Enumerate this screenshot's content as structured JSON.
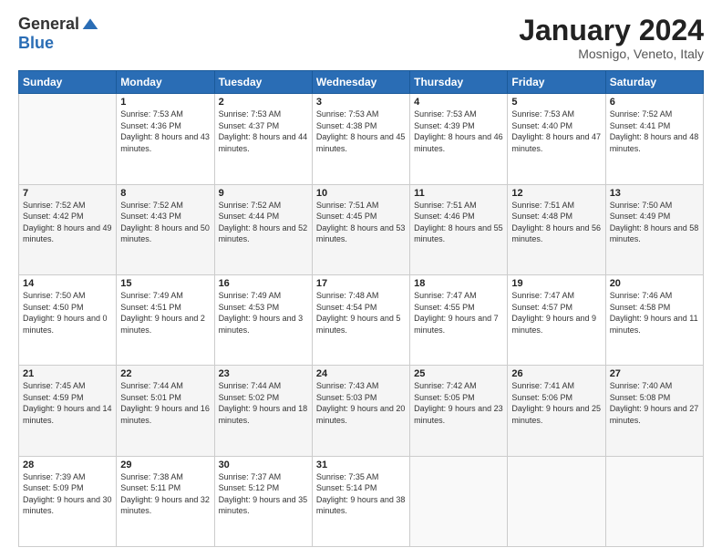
{
  "logo": {
    "general": "General",
    "blue": "Blue"
  },
  "header": {
    "month": "January 2024",
    "location": "Mosnigo, Veneto, Italy"
  },
  "weekdays": [
    "Sunday",
    "Monday",
    "Tuesday",
    "Wednesday",
    "Thursday",
    "Friday",
    "Saturday"
  ],
  "weeks": [
    [
      {
        "day": "",
        "sunrise": "",
        "sunset": "",
        "daylight": ""
      },
      {
        "day": "1",
        "sunrise": "Sunrise: 7:53 AM",
        "sunset": "Sunset: 4:36 PM",
        "daylight": "Daylight: 8 hours and 43 minutes."
      },
      {
        "day": "2",
        "sunrise": "Sunrise: 7:53 AM",
        "sunset": "Sunset: 4:37 PM",
        "daylight": "Daylight: 8 hours and 44 minutes."
      },
      {
        "day": "3",
        "sunrise": "Sunrise: 7:53 AM",
        "sunset": "Sunset: 4:38 PM",
        "daylight": "Daylight: 8 hours and 45 minutes."
      },
      {
        "day": "4",
        "sunrise": "Sunrise: 7:53 AM",
        "sunset": "Sunset: 4:39 PM",
        "daylight": "Daylight: 8 hours and 46 minutes."
      },
      {
        "day": "5",
        "sunrise": "Sunrise: 7:53 AM",
        "sunset": "Sunset: 4:40 PM",
        "daylight": "Daylight: 8 hours and 47 minutes."
      },
      {
        "day": "6",
        "sunrise": "Sunrise: 7:52 AM",
        "sunset": "Sunset: 4:41 PM",
        "daylight": "Daylight: 8 hours and 48 minutes."
      }
    ],
    [
      {
        "day": "7",
        "sunrise": "Sunrise: 7:52 AM",
        "sunset": "Sunset: 4:42 PM",
        "daylight": "Daylight: 8 hours and 49 minutes."
      },
      {
        "day": "8",
        "sunrise": "Sunrise: 7:52 AM",
        "sunset": "Sunset: 4:43 PM",
        "daylight": "Daylight: 8 hours and 50 minutes."
      },
      {
        "day": "9",
        "sunrise": "Sunrise: 7:52 AM",
        "sunset": "Sunset: 4:44 PM",
        "daylight": "Daylight: 8 hours and 52 minutes."
      },
      {
        "day": "10",
        "sunrise": "Sunrise: 7:51 AM",
        "sunset": "Sunset: 4:45 PM",
        "daylight": "Daylight: 8 hours and 53 minutes."
      },
      {
        "day": "11",
        "sunrise": "Sunrise: 7:51 AM",
        "sunset": "Sunset: 4:46 PM",
        "daylight": "Daylight: 8 hours and 55 minutes."
      },
      {
        "day": "12",
        "sunrise": "Sunrise: 7:51 AM",
        "sunset": "Sunset: 4:48 PM",
        "daylight": "Daylight: 8 hours and 56 minutes."
      },
      {
        "day": "13",
        "sunrise": "Sunrise: 7:50 AM",
        "sunset": "Sunset: 4:49 PM",
        "daylight": "Daylight: 8 hours and 58 minutes."
      }
    ],
    [
      {
        "day": "14",
        "sunrise": "Sunrise: 7:50 AM",
        "sunset": "Sunset: 4:50 PM",
        "daylight": "Daylight: 9 hours and 0 minutes."
      },
      {
        "day": "15",
        "sunrise": "Sunrise: 7:49 AM",
        "sunset": "Sunset: 4:51 PM",
        "daylight": "Daylight: 9 hours and 2 minutes."
      },
      {
        "day": "16",
        "sunrise": "Sunrise: 7:49 AM",
        "sunset": "Sunset: 4:53 PM",
        "daylight": "Daylight: 9 hours and 3 minutes."
      },
      {
        "day": "17",
        "sunrise": "Sunrise: 7:48 AM",
        "sunset": "Sunset: 4:54 PM",
        "daylight": "Daylight: 9 hours and 5 minutes."
      },
      {
        "day": "18",
        "sunrise": "Sunrise: 7:47 AM",
        "sunset": "Sunset: 4:55 PM",
        "daylight": "Daylight: 9 hours and 7 minutes."
      },
      {
        "day": "19",
        "sunrise": "Sunrise: 7:47 AM",
        "sunset": "Sunset: 4:57 PM",
        "daylight": "Daylight: 9 hours and 9 minutes."
      },
      {
        "day": "20",
        "sunrise": "Sunrise: 7:46 AM",
        "sunset": "Sunset: 4:58 PM",
        "daylight": "Daylight: 9 hours and 11 minutes."
      }
    ],
    [
      {
        "day": "21",
        "sunrise": "Sunrise: 7:45 AM",
        "sunset": "Sunset: 4:59 PM",
        "daylight": "Daylight: 9 hours and 14 minutes."
      },
      {
        "day": "22",
        "sunrise": "Sunrise: 7:44 AM",
        "sunset": "Sunset: 5:01 PM",
        "daylight": "Daylight: 9 hours and 16 minutes."
      },
      {
        "day": "23",
        "sunrise": "Sunrise: 7:44 AM",
        "sunset": "Sunset: 5:02 PM",
        "daylight": "Daylight: 9 hours and 18 minutes."
      },
      {
        "day": "24",
        "sunrise": "Sunrise: 7:43 AM",
        "sunset": "Sunset: 5:03 PM",
        "daylight": "Daylight: 9 hours and 20 minutes."
      },
      {
        "day": "25",
        "sunrise": "Sunrise: 7:42 AM",
        "sunset": "Sunset: 5:05 PM",
        "daylight": "Daylight: 9 hours and 23 minutes."
      },
      {
        "day": "26",
        "sunrise": "Sunrise: 7:41 AM",
        "sunset": "Sunset: 5:06 PM",
        "daylight": "Daylight: 9 hours and 25 minutes."
      },
      {
        "day": "27",
        "sunrise": "Sunrise: 7:40 AM",
        "sunset": "Sunset: 5:08 PM",
        "daylight": "Daylight: 9 hours and 27 minutes."
      }
    ],
    [
      {
        "day": "28",
        "sunrise": "Sunrise: 7:39 AM",
        "sunset": "Sunset: 5:09 PM",
        "daylight": "Daylight: 9 hours and 30 minutes."
      },
      {
        "day": "29",
        "sunrise": "Sunrise: 7:38 AM",
        "sunset": "Sunset: 5:11 PM",
        "daylight": "Daylight: 9 hours and 32 minutes."
      },
      {
        "day": "30",
        "sunrise": "Sunrise: 7:37 AM",
        "sunset": "Sunset: 5:12 PM",
        "daylight": "Daylight: 9 hours and 35 minutes."
      },
      {
        "day": "31",
        "sunrise": "Sunrise: 7:35 AM",
        "sunset": "Sunset: 5:14 PM",
        "daylight": "Daylight: 9 hours and 38 minutes."
      },
      {
        "day": "",
        "sunrise": "",
        "sunset": "",
        "daylight": ""
      },
      {
        "day": "",
        "sunrise": "",
        "sunset": "",
        "daylight": ""
      },
      {
        "day": "",
        "sunrise": "",
        "sunset": "",
        "daylight": ""
      }
    ]
  ]
}
